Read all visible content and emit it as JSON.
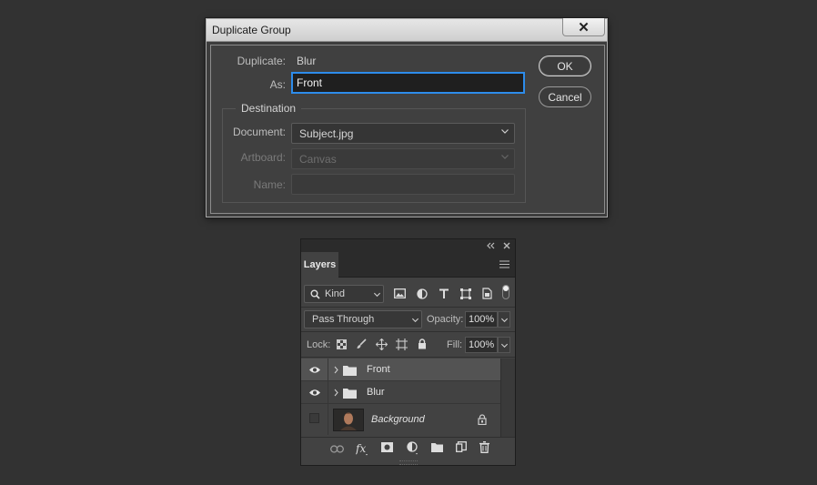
{
  "dialog": {
    "title": "Duplicate Group",
    "close_glyph": "✕",
    "duplicate_label": "Duplicate:",
    "duplicate_value": "Blur",
    "as_label": "As:",
    "as_value": "Front",
    "destination_legend": "Destination",
    "document_label": "Document:",
    "document_value": "Subject.jpg",
    "artboard_label": "Artboard:",
    "artboard_value": "Canvas",
    "name_label": "Name:",
    "name_value": "",
    "ok_label": "OK",
    "cancel_label": "Cancel",
    "accent_color": "#2d8ceb"
  },
  "layers_panel": {
    "tab_label": "Layers",
    "filter_kind": "Kind",
    "blend_mode": "Pass Through",
    "opacity_label": "Opacity:",
    "opacity_value": "100%",
    "lock_label": "Lock:",
    "fill_label": "Fill:",
    "fill_value": "100%",
    "layers": [
      {
        "name": "Front",
        "type": "group",
        "visible": true,
        "selected": true
      },
      {
        "name": "Blur",
        "type": "group",
        "visible": true,
        "selected": false
      },
      {
        "name": "Background",
        "type": "image",
        "visible": false,
        "locked": true,
        "selected": false
      }
    ],
    "filter_icons": [
      "image-filter-icon",
      "adjustment-filter-icon",
      "type-filter-icon",
      "shape-filter-icon",
      "smart-object-filter-icon"
    ],
    "lock_icons": [
      "lock-transparent-icon",
      "lock-image-icon",
      "lock-position-icon",
      "lock-artboard-icon",
      "lock-all-icon"
    ],
    "bottom_icons": [
      "link-layers-icon",
      "fx-icon",
      "add-mask-icon",
      "adjustment-layer-icon",
      "new-group-icon",
      "new-layer-icon",
      "delete-icon"
    ]
  }
}
